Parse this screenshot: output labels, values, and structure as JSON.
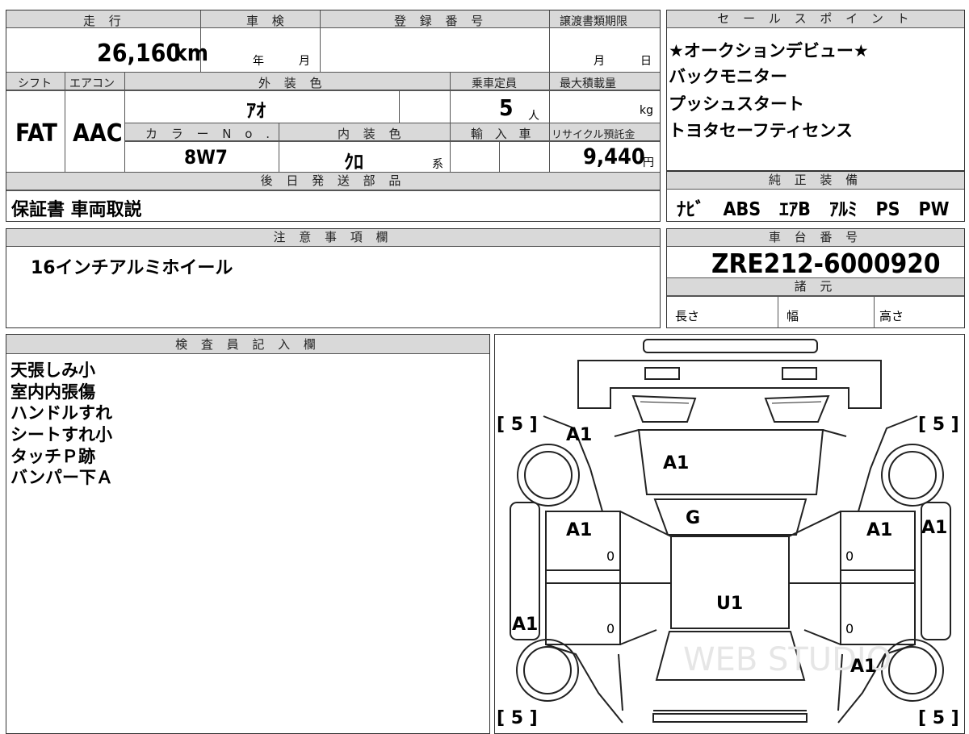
{
  "vehicle_info": {
    "headers": {
      "mileage": "走 行",
      "inspection": "車 検",
      "registration": "登 録 番 号",
      "transfer_deadline": "譲渡書類期限",
      "shift": "シフト",
      "aircon": "エアコン",
      "exterior_color": "外 装 色",
      "capacity": "乗車定員",
      "max_load": "最大積載量",
      "color_no": "カ ラ ー N o .",
      "interior_color": "内 装 色",
      "import": "輸 入 車",
      "recycle": "リサイクル預託金",
      "later_parts": "後 日 発 送 部 品"
    },
    "mileage_value": "26,160",
    "mileage_unit": "km",
    "inspection_year_label": "年",
    "inspection_month_label": "月",
    "transfer_month_label": "月",
    "transfer_day_label": "日",
    "shift_value": "FAT",
    "aircon_value": "AAC",
    "exterior_color_value": "ｱｵ",
    "capacity_value": "5",
    "capacity_unit": "人",
    "max_load_unit": "kg",
    "color_no_value": "8W7",
    "interior_color_value": "ｸﾛ",
    "interior_color_suffix": "系",
    "recycle_value": "9,440",
    "recycle_unit": "円",
    "later_parts_value": "保証書 車両取説"
  },
  "sales_points": {
    "header": "セ ー ル ス ポ イ ン ト",
    "items": [
      "★オークションデビュー★",
      "バックモニター",
      "プッシュスタート",
      "トヨタセーフティセンス"
    ]
  },
  "genuine_equipment": {
    "header": "純 正 装 備",
    "value": "ﾅﾋﾞ　ABS　ｴｱB　ｱﾙﾐ　PS　PW"
  },
  "notes": {
    "header": "注 意 事 項 欄",
    "value": "16インチアルミホイール"
  },
  "chassis": {
    "header": "車 台 番 号",
    "value": "ZRE212-6000920",
    "specs_header": "諸 元",
    "length_label": "長さ",
    "width_label": "幅",
    "height_label": "高さ"
  },
  "inspector": {
    "header": "検 査 員 記 入 欄",
    "lines": [
      "天張しみ小",
      "室内内張傷",
      "ハンドルすれ",
      "シートすれ小",
      "タッチＰ跡",
      "バンパー下Ａ"
    ]
  },
  "diagram": {
    "tire_top_left": "[ 5 ]",
    "tire_top_right": "[ 5 ]",
    "tire_bottom_left": "[ 5 ]",
    "tire_bottom_right": "[ 5 ]",
    "mark_front_left_fender": "A1",
    "mark_hood": "A1",
    "mark_windshield": "G",
    "mark_roof": "U1",
    "mark_front_left_door": "A1",
    "mark_front_right_door": "A1",
    "mark_right_step": "A1",
    "mark_left_step": "A1",
    "mark_rear_right_fender": "A1",
    "zero_1": "0",
    "zero_2": "0",
    "zero_3": "0",
    "zero_4": "0",
    "watermark": "WEB STUDIO"
  }
}
